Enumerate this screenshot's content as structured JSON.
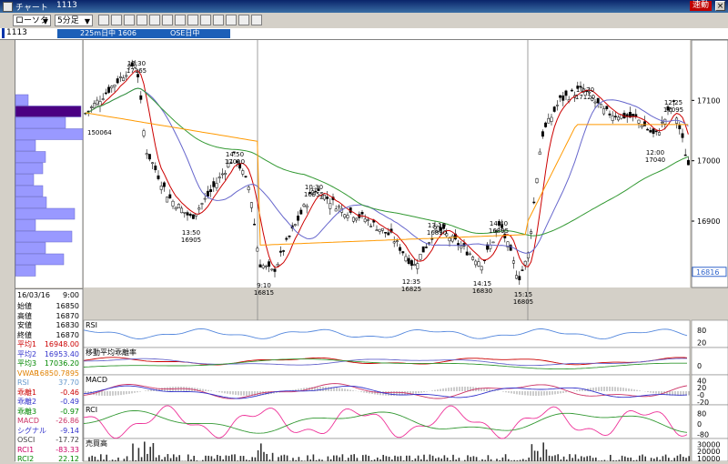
{
  "window": {
    "icon": "chart-window-icon",
    "title": "チャート",
    "code": "1113",
    "speed_button": "速動",
    "close_glyph": "×"
  },
  "toolbar": {
    "chart_type": "ローソク",
    "interval": "5分足",
    "dropdown_arrow": "▼",
    "icons": [
      "candle-chart-icon",
      "bar-chart-icon",
      "line-chart-icon",
      "point-figure-icon",
      "trend-line-icon",
      "fibonacci-icon",
      "zoom-icon",
      "print-icon",
      "table-icon",
      "pen-icon",
      "eraser-icon",
      "search-icon",
      "settings-icon"
    ]
  },
  "infobar": {
    "code": "1113",
    "status_left": "225m日中 1606",
    "status_right": "OSE日中"
  },
  "main_chart": {
    "price_labels": [
      "17100",
      "17000",
      "16900"
    ],
    "current_price": "16816",
    "ylim": [
      16790,
      17200
    ],
    "annotations": [
      {
        "time": "12:30",
        "price": "17165"
      },
      {
        "time": "14:50",
        "price": "17010"
      },
      {
        "time": "13:50",
        "price": "16905"
      },
      {
        "time": "10:30",
        "price": "16955"
      },
      {
        "time": "13:10",
        "price": "16890"
      },
      {
        "time": "14:40",
        "price": "16895"
      },
      {
        "time": "9:10",
        "price": "16815"
      },
      {
        "time": "12:35",
        "price": "16825"
      },
      {
        "time": "14:15",
        "price": "16830"
      },
      {
        "time": "15:15",
        "price": "16805"
      },
      {
        "time": "10:20",
        "price": "17120"
      },
      {
        "time": "12:25",
        "price": "17095"
      },
      {
        "time": "12:00",
        "price": "17040"
      }
    ],
    "marker_label": "150064"
  },
  "volume_profile": [
    14,
    72,
    55,
    74,
    22,
    33,
    30,
    20,
    30,
    34,
    65,
    22,
    62,
    33,
    53,
    22
  ],
  "info_panel": {
    "date": "16/03/16",
    "time": "9:00",
    "rows": [
      {
        "k": "始値",
        "v": "16850",
        "c": "#000000"
      },
      {
        "k": "高値",
        "v": "16870",
        "c": "#000000"
      },
      {
        "k": "安値",
        "v": "16830",
        "c": "#000000"
      },
      {
        "k": "終値",
        "v": "16870",
        "c": "#000000"
      },
      {
        "k": "平均1",
        "v": "16948.00",
        "c": "#cc0000"
      },
      {
        "k": "平均2",
        "v": "16953.40",
        "c": "#3333cc"
      },
      {
        "k": "平均3",
        "v": "17036.20",
        "c": "#008800"
      },
      {
        "k": "VWAP",
        "v": "16850.7895",
        "c": "#e08000"
      },
      {
        "k": "RSI",
        "v": "37.70",
        "c": "#6699cc"
      },
      {
        "k": "乖離1",
        "v": "-0.46",
        "c": "#cc0000"
      },
      {
        "k": "乖離2",
        "v": "-0.49",
        "c": "#3333cc"
      },
      {
        "k": "乖離3",
        "v": "-0.97",
        "c": "#008800"
      },
      {
        "k": "MACD",
        "v": "-26.86",
        "c": "#cc3366"
      },
      {
        "k": "シグナル",
        "v": "-9.14",
        "c": "#3333cc"
      },
      {
        "k": "OSCI",
        "v": "-17.72",
        "c": "#444444"
      },
      {
        "k": "RCI1",
        "v": "-83.33",
        "c": "#cc0066"
      },
      {
        "k": "RCI2",
        "v": "22.12",
        "c": "#008800"
      }
    ]
  },
  "panels": [
    {
      "title": "RSI",
      "labels": [
        "80",
        "20"
      ]
    },
    {
      "title": "移動平均乖離率",
      "labels": [
        "0"
      ]
    },
    {
      "title": "MACD",
      "labels": [
        "40",
        "20",
        "-0",
        "-20"
      ]
    },
    {
      "title": "RCI",
      "labels": [
        "80",
        "0",
        "-80"
      ]
    },
    {
      "title": "売買高",
      "labels": [
        "30000",
        "20000",
        "10000"
      ]
    }
  ],
  "colors": {
    "ma1": "#cc0000",
    "ma2": "#6666cc",
    "ma3": "#339933",
    "vwap": "#ff9900",
    "rsi": "#5588dd",
    "macd": "#cc3366",
    "signal": "#3333cc",
    "rci1": "#ee3399",
    "rci2": "#339933"
  }
}
